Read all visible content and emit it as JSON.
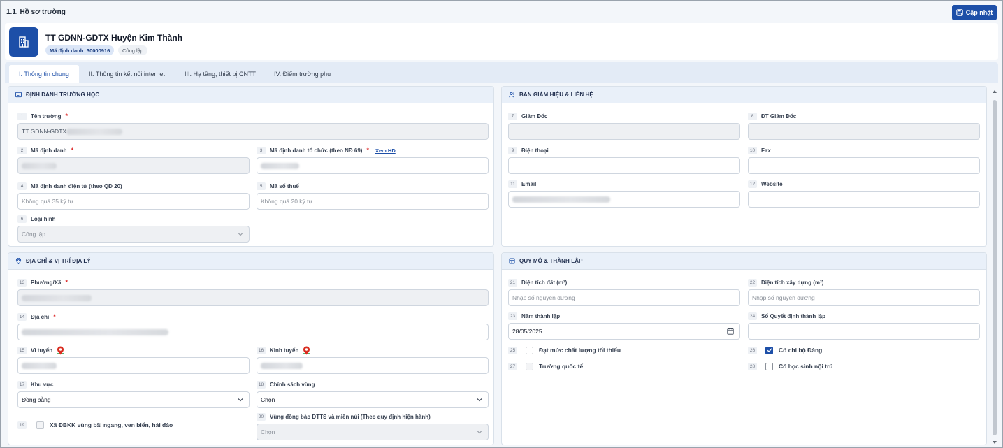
{
  "page": {
    "title": "1.1. Hồ sơ trường",
    "update_label": "Cập nhật"
  },
  "school": {
    "name": "TT GDNN-GDTX Huyện Kim Thành",
    "code_badge": "Mã định danh: 30000916",
    "type_badge": "Công lập"
  },
  "tabs": [
    {
      "label": "I. Thông tin chung",
      "active": true
    },
    {
      "label": "II. Thông tin kết nối internet",
      "active": false
    },
    {
      "label": "III. Hạ tầng, thiết bị CNTT",
      "active": false
    },
    {
      "label": "IV. Điểm trường phụ",
      "active": false
    }
  ],
  "identity": {
    "header": "ĐỊNH DANH TRƯỜNG HỌC",
    "f1": {
      "num": "1",
      "label": "Tên trường",
      "value": "TT GDNN-GDTX"
    },
    "f2": {
      "num": "2",
      "label": "Mã định danh"
    },
    "f3": {
      "num": "3",
      "label": "Mã định danh tổ chức (theo NĐ 69)",
      "link": "Xem HD"
    },
    "f4": {
      "num": "4",
      "label": "Mã định danh điện tử (theo QĐ 20)",
      "placeholder": "Không quá 35 ký tự"
    },
    "f5": {
      "num": "5",
      "label": "Mã số thuế",
      "placeholder": "Không quá 20 ký tự"
    },
    "f6": {
      "num": "6",
      "label": "Loại hình",
      "value": "Công lập"
    }
  },
  "board": {
    "header": "BAN GIÁM HIỆU & LIÊN HỆ",
    "f7": {
      "num": "7",
      "label": "Giám Đốc"
    },
    "f8": {
      "num": "8",
      "label": "ĐT Giám Đốc"
    },
    "f9": {
      "num": "9",
      "label": "Điện thoại"
    },
    "f10": {
      "num": "10",
      "label": "Fax"
    },
    "f11": {
      "num": "11",
      "label": "Email"
    },
    "f12": {
      "num": "12",
      "label": "Website"
    }
  },
  "address": {
    "header": "ĐỊA CHỈ & VỊ TRÍ ĐỊA LÝ",
    "f13": {
      "num": "13",
      "label": "Phường/Xã"
    },
    "f14": {
      "num": "14",
      "label": "Địa chỉ"
    },
    "f15": {
      "num": "15",
      "label": "Vĩ tuyến"
    },
    "f16": {
      "num": "16",
      "label": "Kinh tuyến"
    },
    "f17": {
      "num": "17",
      "label": "Khu vực",
      "value": "Đồng bằng"
    },
    "f18": {
      "num": "18",
      "label": "Chính sách vùng",
      "value": "Chọn"
    },
    "f19": {
      "num": "19",
      "label": "Xã ĐBKK vùng bãi ngang, ven biển, hải đảo"
    },
    "f20": {
      "num": "20",
      "label": "Vùng đồng bào DTTS và miền núi (Theo quy định hiện hành)",
      "value": "Chọn"
    }
  },
  "scale": {
    "header": "QUY MÔ & THÀNH LẬP",
    "f21": {
      "num": "21",
      "label": "Diện tích đất (m²)",
      "placeholder": "Nhập số nguyên dương"
    },
    "f22": {
      "num": "22",
      "label": "Diện tích xây dựng (m²)",
      "placeholder": "Nhập số nguyên dương"
    },
    "f23": {
      "num": "23",
      "label": "Năm thành lập",
      "value": "28/05/2025"
    },
    "f24": {
      "num": "24",
      "label": "Số Quyết định thành lập"
    },
    "f25": {
      "num": "25",
      "label": "Đạt mức chất lượng tối thiểu",
      "checked": false
    },
    "f26": {
      "num": "26",
      "label": "Có chi bộ Đảng",
      "checked": true
    },
    "f27": {
      "num": "27",
      "label": "Trường quốc tế",
      "checked": false
    },
    "f28": {
      "num": "28",
      "label": "Có học sinh nội trú",
      "checked": false
    }
  },
  "colors": {
    "primary": "#1d4fa8",
    "required": "#dc2626",
    "pin": "#d92d20"
  }
}
